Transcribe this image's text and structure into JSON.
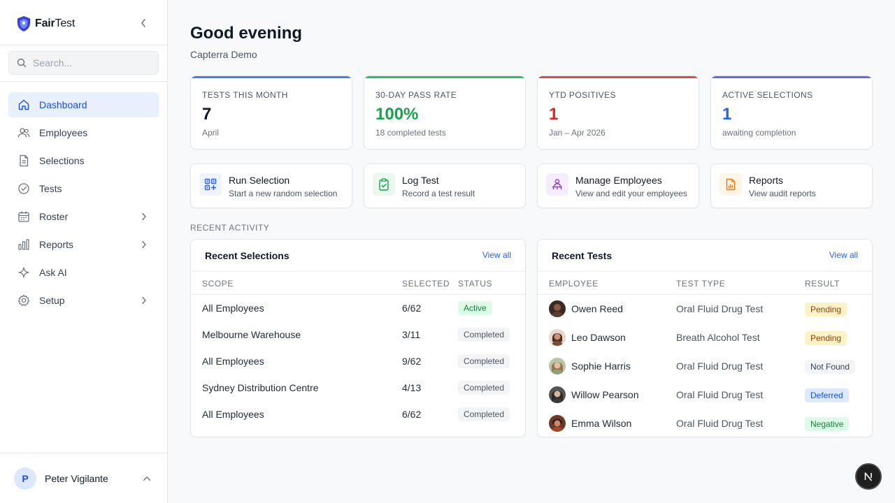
{
  "brand": {
    "name_bold": "Fair",
    "name_regular": "Test",
    "accent": "#2563eb"
  },
  "search": {
    "placeholder": "Search..."
  },
  "sidebar": {
    "items": [
      {
        "label": "Dashboard",
        "icon": "home-icon",
        "active": true
      },
      {
        "label": "Employees",
        "icon": "users-icon"
      },
      {
        "label": "Selections",
        "icon": "document-icon"
      },
      {
        "label": "Tests",
        "icon": "check-circle-icon"
      },
      {
        "label": "Roster",
        "icon": "calendar-icon",
        "expandable": true
      },
      {
        "label": "Reports",
        "icon": "bar-chart-icon",
        "expandable": true
      },
      {
        "label": "Ask AI",
        "icon": "sparkle-icon"
      },
      {
        "label": "Setup",
        "icon": "gear-icon",
        "expandable": true
      }
    ]
  },
  "user": {
    "initial": "P",
    "name": "Peter Vigilante"
  },
  "header": {
    "greeting": "Good evening",
    "org": "Capterra Demo"
  },
  "stats": [
    {
      "label": "TESTS THIS MONTH",
      "value": "7",
      "sub": "April",
      "color": "#3b82f6",
      "value_color": "#111827"
    },
    {
      "label": "30-DAY PASS RATE",
      "value": "100%",
      "sub": "18 completed tests",
      "color": "#22c55e",
      "value_color": "#16a34a"
    },
    {
      "label": "YTD POSITIVES",
      "value": "1",
      "sub": "Jan – Apr 2026",
      "color": "#ef4444",
      "value_color": "#dc2626"
    },
    {
      "label": "ACTIVE SELECTIONS",
      "value": "1",
      "sub": "awaiting completion",
      "color": "#6366f1",
      "value_color": "#2563eb"
    }
  ],
  "actions": [
    {
      "title": "Run Selection",
      "sub": "Start a new random selection",
      "icon": "qr-shuffle-icon"
    },
    {
      "title": "Log Test",
      "sub": "Record a test result",
      "icon": "clipboard-check-icon"
    },
    {
      "title": "Manage Employees",
      "sub": "View and edit your employees",
      "icon": "org-chart-icon"
    },
    {
      "title": "Reports",
      "sub": "View audit reports",
      "icon": "report-file-icon"
    }
  ],
  "section": {
    "recent_activity": "RECENT ACTIVITY"
  },
  "recent_selections": {
    "title": "Recent Selections",
    "view_all": "View all",
    "columns": [
      "SCOPE",
      "SELECTED",
      "STATUS"
    ],
    "rows": [
      {
        "scope": "All Employees",
        "selected": "6/62",
        "status": "Active"
      },
      {
        "scope": "Melbourne Warehouse",
        "selected": "3/11",
        "status": "Completed"
      },
      {
        "scope": "All Employees",
        "selected": "9/62",
        "status": "Completed"
      },
      {
        "scope": "Sydney Distribution Centre",
        "selected": "4/13",
        "status": "Completed"
      },
      {
        "scope": "All Employees",
        "selected": "6/62",
        "status": "Completed"
      }
    ]
  },
  "recent_tests": {
    "title": "Recent Tests",
    "view_all": "View all",
    "columns": [
      "EMPLOYEE",
      "TEST TYPE",
      "RESULT"
    ],
    "rows": [
      {
        "employee": "Owen Reed",
        "test_type": "Oral Fluid Drug Test",
        "result": "Pending"
      },
      {
        "employee": "Leo Dawson",
        "test_type": "Breath Alcohol Test",
        "result": "Pending"
      },
      {
        "employee": "Sophie Harris",
        "test_type": "Oral Fluid Drug Test",
        "result": "Not Found"
      },
      {
        "employee": "Willow Pearson",
        "test_type": "Oral Fluid Drug Test",
        "result": "Deferred"
      },
      {
        "employee": "Emma Wilson",
        "test_type": "Oral Fluid Drug Test",
        "result": "Negative"
      }
    ]
  },
  "fab": {
    "label": "N"
  }
}
